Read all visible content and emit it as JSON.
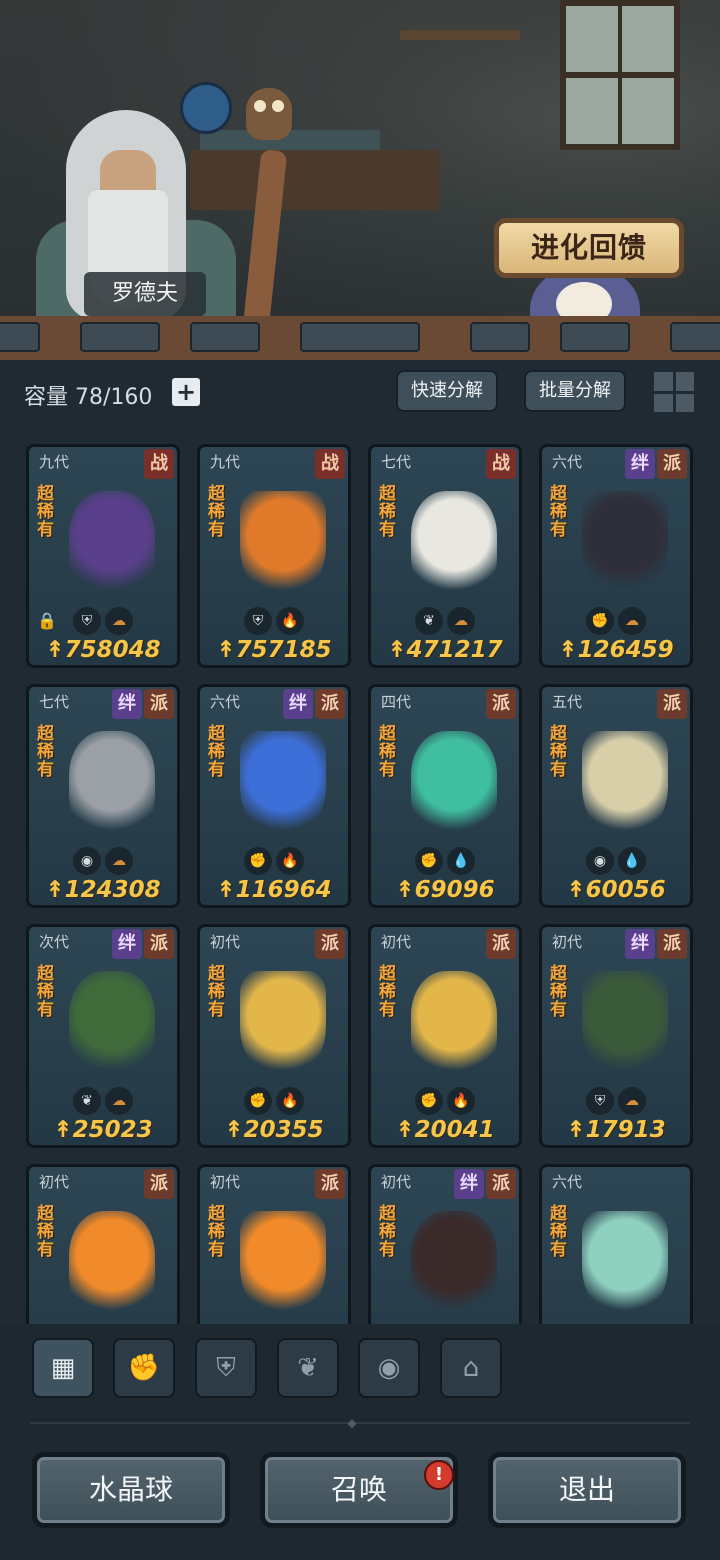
{
  "scene": {
    "npc_name": "罗德夫",
    "evolve_label": "进化回馈"
  },
  "storage": {
    "label": "容量",
    "used": "78",
    "total": "160",
    "plus_label": "+"
  },
  "toolbar": {
    "quick_decompose": "快速分解",
    "batch_decompose": "批量分解"
  },
  "colors": {
    "accent_orange": "#f3a73a",
    "power_gold": "#f5c64a",
    "tag_war": "#7a2f2a",
    "tag_bond": "#5a3f8c",
    "tag_faction": "#6e3a2c"
  },
  "cards": [
    {
      "gen": "九代",
      "tags": [
        "战"
      ],
      "rarity": "超稀有",
      "power": "758048",
      "locked": true,
      "elements": [
        {
          "icon": "shield-icon",
          "glyph": "⛨",
          "tone": "white"
        },
        {
          "icon": "earth-icon",
          "glyph": "☁",
          "tone": "orange"
        }
      ],
      "color": "#5a3f8c"
    },
    {
      "gen": "九代",
      "tags": [
        "战"
      ],
      "rarity": "超稀有",
      "power": "757185",
      "locked": false,
      "elements": [
        {
          "icon": "shield-icon",
          "glyph": "⛨",
          "tone": "white"
        },
        {
          "icon": "fire-icon",
          "glyph": "🔥",
          "tone": "red"
        }
      ],
      "color": "#e07a2a"
    },
    {
      "gen": "七代",
      "tags": [
        "战"
      ],
      "rarity": "超稀有",
      "power": "471217",
      "locked": false,
      "elements": [
        {
          "icon": "leaf-icon",
          "glyph": "❦",
          "tone": "white"
        },
        {
          "icon": "earth-icon",
          "glyph": "☁",
          "tone": "orange"
        }
      ],
      "color": "#e8e8e0"
    },
    {
      "gen": "六代",
      "tags": [
        "绊",
        "派"
      ],
      "rarity": "超稀有",
      "power": "126459",
      "locked": false,
      "elements": [
        {
          "icon": "fist-icon",
          "glyph": "✊",
          "tone": "white"
        },
        {
          "icon": "earth-icon",
          "glyph": "☁",
          "tone": "orange"
        }
      ],
      "color": "#2f2f3a"
    },
    {
      "gen": "七代",
      "tags": [
        "绊",
        "派"
      ],
      "rarity": "超稀有",
      "power": "124308",
      "locked": false,
      "elements": [
        {
          "icon": "alien-icon",
          "glyph": "◉",
          "tone": "white"
        },
        {
          "icon": "earth-icon",
          "glyph": "☁",
          "tone": "orange"
        }
      ],
      "color": "#9aa0a6"
    },
    {
      "gen": "六代",
      "tags": [
        "绊",
        "派"
      ],
      "rarity": "超稀有",
      "power": "116964",
      "locked": false,
      "elements": [
        {
          "icon": "fist-icon",
          "glyph": "✊",
          "tone": "white"
        },
        {
          "icon": "fire-icon",
          "glyph": "🔥",
          "tone": "red"
        }
      ],
      "color": "#3d6fd9"
    },
    {
      "gen": "四代",
      "tags": [
        "派"
      ],
      "rarity": "超稀有",
      "power": "69096",
      "locked": false,
      "elements": [
        {
          "icon": "fist-icon",
          "glyph": "✊",
          "tone": "white"
        },
        {
          "icon": "water-icon",
          "glyph": "💧",
          "tone": "blue"
        }
      ],
      "color": "#3fbfa0"
    },
    {
      "gen": "五代",
      "tags": [
        "派"
      ],
      "rarity": "超稀有",
      "power": "60056",
      "locked": false,
      "elements": [
        {
          "icon": "alien-icon",
          "glyph": "◉",
          "tone": "white"
        },
        {
          "icon": "water-icon",
          "glyph": "💧",
          "tone": "blue"
        }
      ],
      "color": "#d8cfa8"
    },
    {
      "gen": "次代",
      "tags": [
        "绊",
        "派"
      ],
      "rarity": "超稀有",
      "power": "25023",
      "locked": false,
      "elements": [
        {
          "icon": "leaf-icon",
          "glyph": "❦",
          "tone": "white"
        },
        {
          "icon": "earth-icon",
          "glyph": "☁",
          "tone": "orange"
        }
      ],
      "color": "#3f6a3a"
    },
    {
      "gen": "初代",
      "tags": [
        "派"
      ],
      "rarity": "超稀有",
      "power": "20355",
      "locked": false,
      "elements": [
        {
          "icon": "fist-icon",
          "glyph": "✊",
          "tone": "white"
        },
        {
          "icon": "fire-icon",
          "glyph": "🔥",
          "tone": "red"
        }
      ],
      "color": "#e3b64a"
    },
    {
      "gen": "初代",
      "tags": [
        "派"
      ],
      "rarity": "超稀有",
      "power": "20041",
      "locked": false,
      "elements": [
        {
          "icon": "fist-icon",
          "glyph": "✊",
          "tone": "white"
        },
        {
          "icon": "fire-icon",
          "glyph": "🔥",
          "tone": "red"
        }
      ],
      "color": "#e3b64a"
    },
    {
      "gen": "初代",
      "tags": [
        "绊",
        "派"
      ],
      "rarity": "超稀有",
      "power": "17913",
      "locked": false,
      "elements": [
        {
          "icon": "shield-icon",
          "glyph": "⛨",
          "tone": "white"
        },
        {
          "icon": "earth-icon",
          "glyph": "☁",
          "tone": "orange"
        }
      ],
      "color": "#3b5a3a"
    },
    {
      "gen": "初代",
      "tags": [
        "派"
      ],
      "rarity": "超稀有",
      "power": "",
      "locked": false,
      "elements": [],
      "color": "#f08a2a"
    },
    {
      "gen": "初代",
      "tags": [
        "派"
      ],
      "rarity": "超稀有",
      "power": "",
      "locked": false,
      "elements": [],
      "color": "#f08a2a"
    },
    {
      "gen": "初代",
      "tags": [
        "绊",
        "派"
      ],
      "rarity": "超稀有",
      "power": "",
      "locked": false,
      "elements": [],
      "color": "#3a2a2a"
    },
    {
      "gen": "六代",
      "tags": [],
      "rarity": "超稀有",
      "power": "",
      "locked": false,
      "elements": [],
      "color": "#8fd1bf"
    }
  ],
  "filters": [
    {
      "icon": "all-icon",
      "glyph": "▦",
      "active": true
    },
    {
      "icon": "fist-icon",
      "glyph": "✊",
      "active": false
    },
    {
      "icon": "shield-icon",
      "glyph": "⛨",
      "active": false
    },
    {
      "icon": "leaf-icon",
      "glyph": "❦",
      "active": false
    },
    {
      "icon": "alien-icon",
      "glyph": "◉",
      "active": false
    },
    {
      "icon": "tower-icon",
      "glyph": "⌂",
      "active": false
    }
  ],
  "bottom": {
    "crystal_ball": "水晶球",
    "summon": "召唤",
    "summon_alert": "!",
    "exit": "退出"
  }
}
